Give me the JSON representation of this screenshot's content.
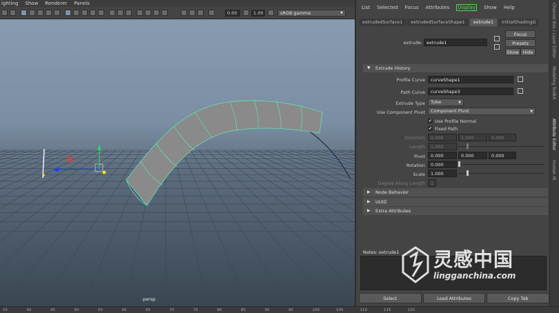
{
  "viewport": {
    "menu": [
      "ighting",
      "Show",
      "Renderer",
      "Panels"
    ],
    "toolbar": {
      "exposure": "0.00",
      "gamma": "1.00",
      "color_space": "sRGB gamma"
    },
    "camera_label": "persp"
  },
  "ruler_ticks": [
    "15",
    "40",
    "45",
    "50",
    "55",
    "60",
    "65",
    "70",
    "75",
    "80",
    "85",
    "90",
    "95",
    "100",
    "105",
    "110",
    "115",
    "120"
  ],
  "attribute_editor": {
    "menu": [
      "List",
      "Selected",
      "Focus",
      "Attributes",
      "Display",
      "Show",
      "Help"
    ],
    "tabs": [
      "extrudedSurface1",
      "extrudedSurfaceShape1",
      "extrude1",
      "initialShadingG"
    ],
    "active_tab": "extrude1",
    "node_label": "extrude:",
    "node_name": "extrude1",
    "buttons": {
      "focus": "Focus",
      "presets": "Presets",
      "show": "Show",
      "hide": "Hide"
    },
    "extrude_history": {
      "title": "Extrude History",
      "profile_curve_label": "Profile Curve",
      "profile_curve": "curveShape1",
      "path_curve_label": "Path Curve",
      "path_curve": "curveShape3",
      "extrude_type_label": "Extrude Type",
      "extrude_type": "Tube",
      "use_component_pivot_label": "Use Component Pivot",
      "use_component_pivot": "Component Pivot",
      "use_profile_normal": "Use Profile Normal",
      "fixed_path": "Fixed Path",
      "direction_label": "Direction",
      "direction": [
        "0.000",
        "1.000",
        "0.000"
      ],
      "length_label": "Length",
      "length": "1.000",
      "pivot_label": "Pivot",
      "pivot": [
        "0.000",
        "0.000",
        "0.000"
      ],
      "rotation_label": "Rotation",
      "rotation": "0.000",
      "scale_label": "Scale",
      "scale": "1.000",
      "degree_label": "Degree Along Length",
      "degree": "1"
    },
    "sections": [
      "Node Behavior",
      "UUID",
      "Extra Attributes"
    ],
    "notes_label": "Notes: extrude1",
    "bottom_buttons": [
      "Select",
      "Load Attributes",
      "Copy Tab"
    ]
  },
  "side_tabs": [
    "Channel Box / Layer Editor",
    "Modeling Toolkit",
    "Attribute Editor",
    "Human IK"
  ],
  "watermark": {
    "chinese": "灵感中国",
    "url": "lingganchina.com"
  },
  "colors": {
    "display_green": "#55d155",
    "viewport_top": "#8a9db2",
    "grid": "#3b4754"
  }
}
